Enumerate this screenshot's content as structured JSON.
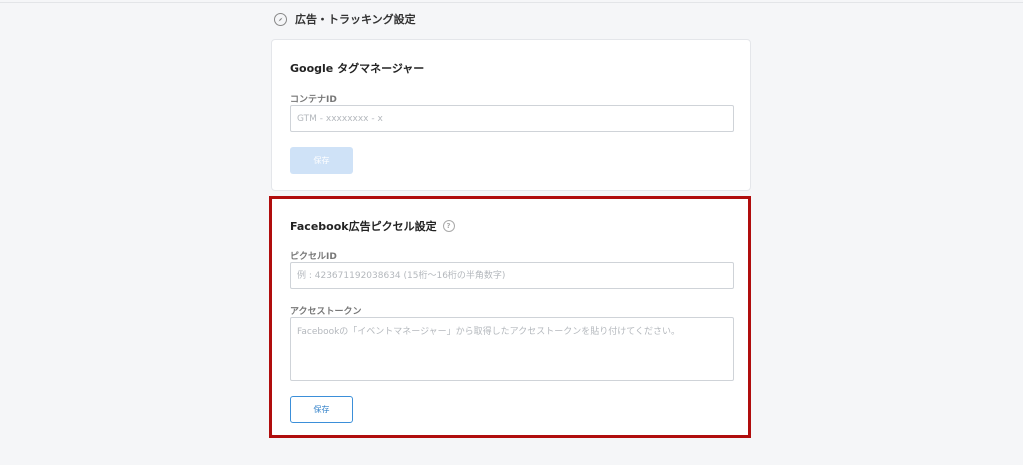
{
  "section": {
    "title": "広告・トラッキング設定",
    "icon": "compass-icon"
  },
  "gtm": {
    "title": "Google タグマネージャー",
    "container_label": "コンテナID",
    "container_placeholder": "GTM - xxxxxxxx - x",
    "save_label": "保存"
  },
  "facebook": {
    "title": "Facebook広告ピクセル設定",
    "help_icon": "help-circle-icon",
    "help_glyph": "?",
    "pixel_label": "ピクセルID",
    "pixel_placeholder": "例 : 423671192038634 (15桁〜16桁の半角数字)",
    "token_label": "アクセストークン",
    "token_placeholder": "Facebookの「イベントマネージャー」から取得したアクセストークンを貼り付けてください。",
    "save_label": "保存"
  },
  "colors": {
    "highlight": "#b00d0d",
    "accent": "#3b8fd9",
    "disabled": "#cfe2f7"
  }
}
